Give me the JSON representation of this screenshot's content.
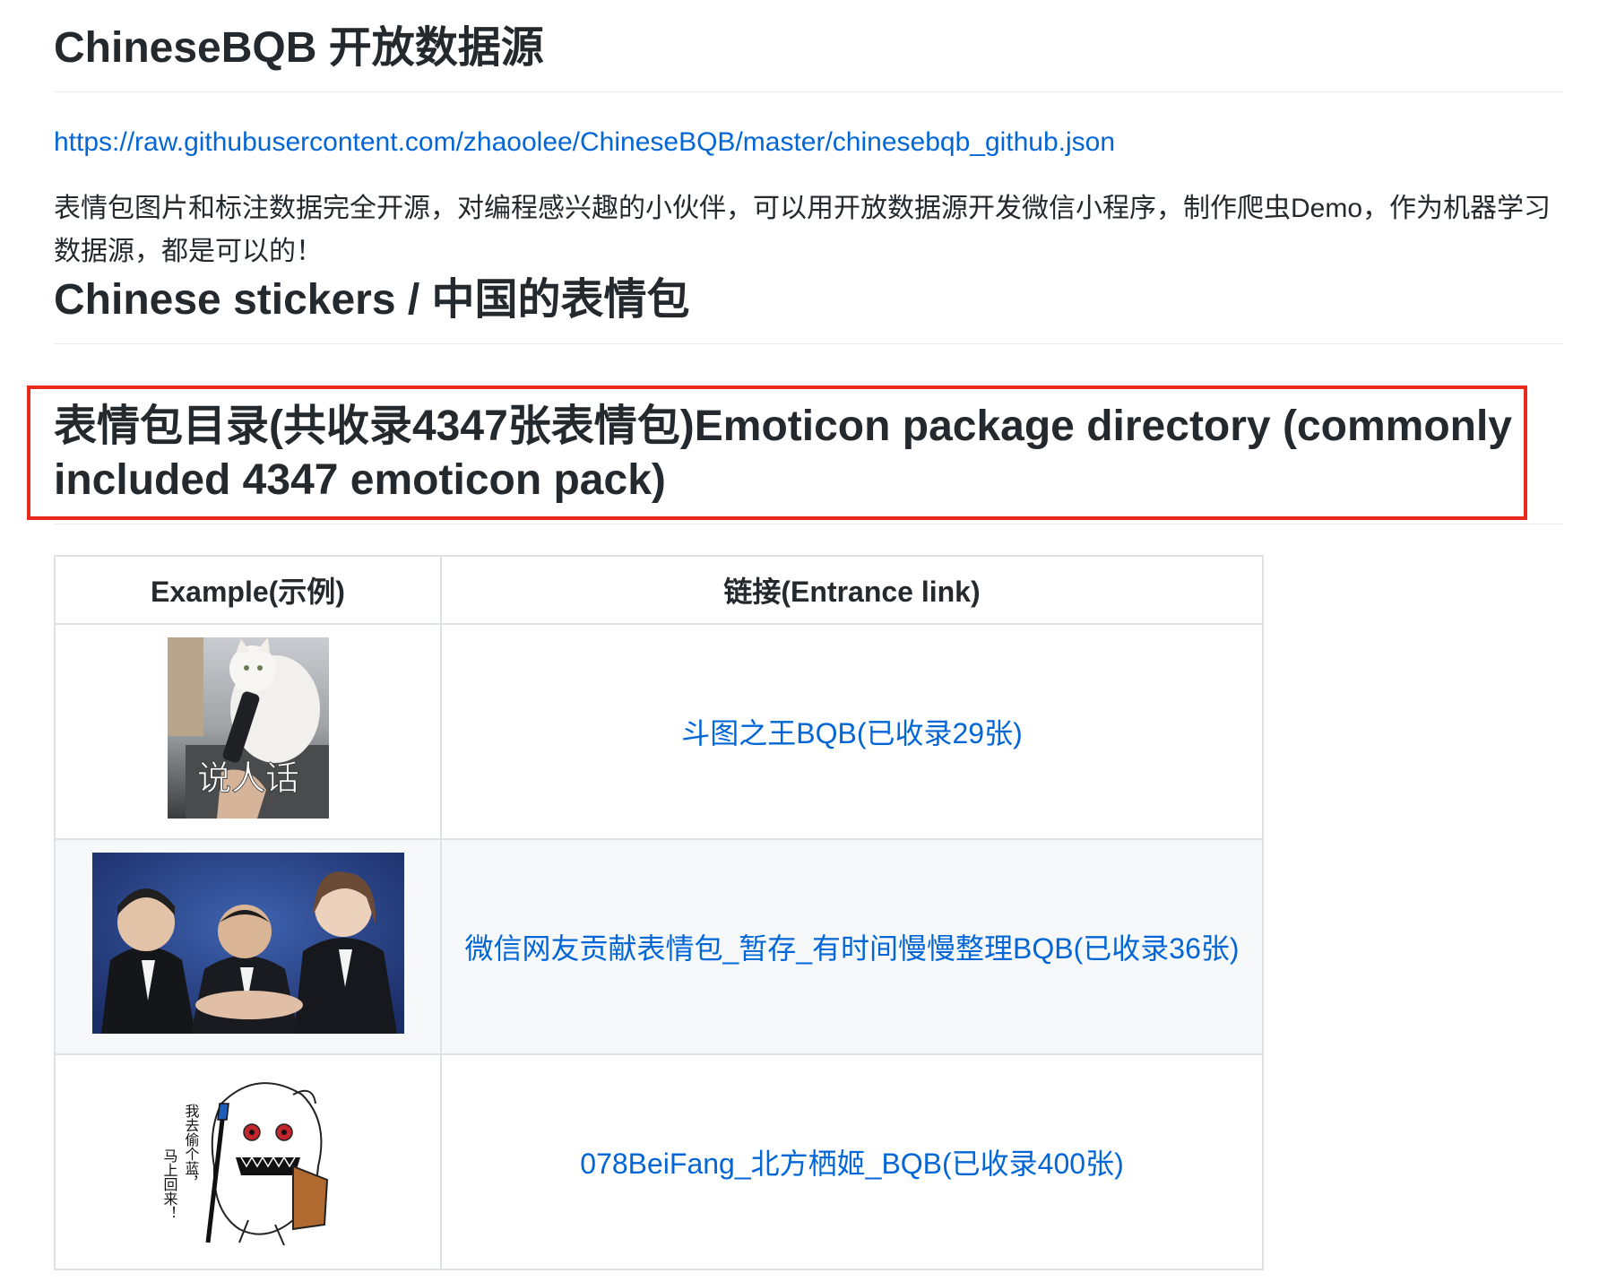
{
  "heading1": "ChineseBQB 开放数据源",
  "data_source_link": "https://raw.githubusercontent.com/zhaoolee/ChineseBQB/master/chinesebqb_github.json",
  "description": "表情包图片和标注数据完全开源，对编程感兴趣的小伙伴，可以用开放数据源开发微信小程序，制作爬虫Demo，作为机器学习数据源，都是可以的！",
  "heading2": "Chinese stickers / 中国的表情包",
  "heading3": "表情包目录(共收录4347张表情包)Emoticon package directory (commonly included 4347 emoticon pack)",
  "table": {
    "headers": [
      "Example(示例)",
      "链接(Entrance link)"
    ],
    "rows": [
      {
        "link_text": "斗图之王BQB(已收录29张)",
        "thumb_caption": "说人话",
        "thumb_icon": "cat-sticker-image"
      },
      {
        "link_text": "微信网友贡献表情包_暂存_有时间慢慢整理BQB(已收录36张)",
        "thumb_icon": "three-people-handshake-image"
      },
      {
        "link_text": "078BeiFang_北方栖姬_BQB(已收录400张)",
        "thumb_caption_right": "我去偷个蓝，",
        "thumb_caption_left": "马上回来！",
        "thumb_icon": "anime-girl-sticker-image"
      }
    ]
  },
  "colors": {
    "link": "#0366d6",
    "text": "#24292e",
    "border": "#dfe2e5",
    "highlight": "#e8291d",
    "stripe": "#f6f8fa"
  }
}
